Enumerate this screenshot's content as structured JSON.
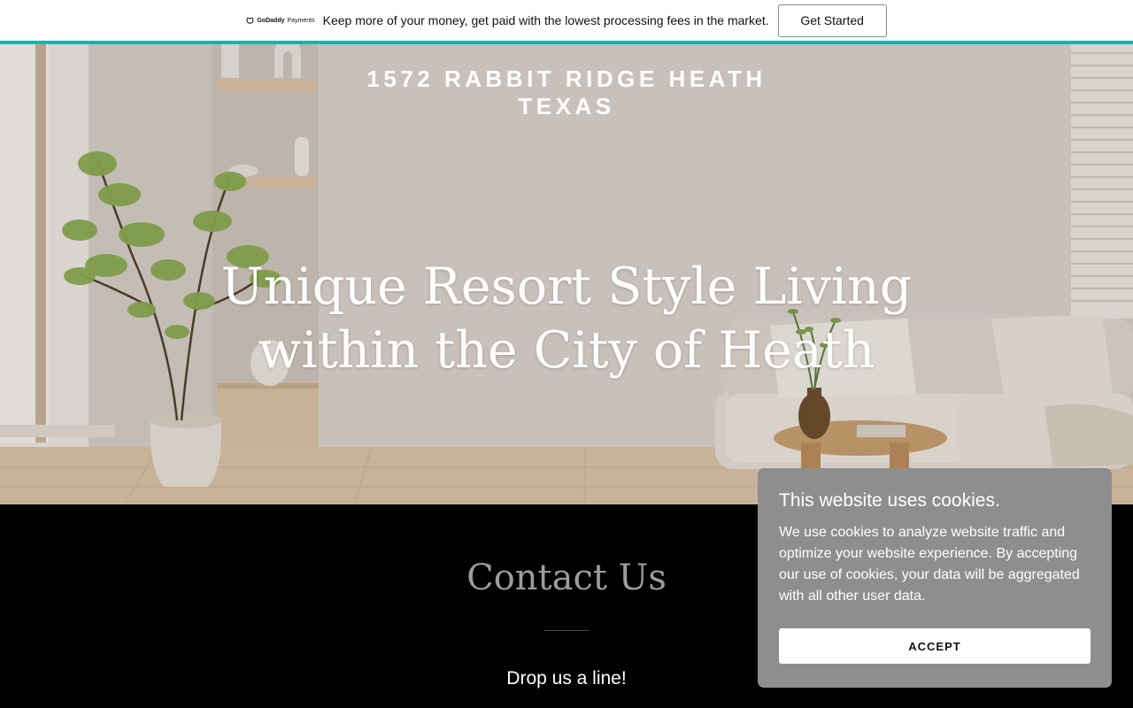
{
  "promo": {
    "logo_brand": "GoDaddy",
    "logo_product": "Payments",
    "message": "Keep more of your money, get paid with the lowest processing fees in the market.",
    "cta_label": "Get Started",
    "accent_color": "#1bb1ad"
  },
  "hero": {
    "site_title_line1": "1572 RABBIT RIDGE HEATH",
    "site_title_line2": "TEXAS",
    "heading_line1": "Unique Resort Style Living",
    "heading_line2": "within the City of Heath"
  },
  "contact": {
    "title": "Contact Us",
    "subtitle": "Drop us a line!"
  },
  "cookie_banner": {
    "title": "This website uses cookies.",
    "body": "We use cookies to analyze website traffic and optimize your website experience. By accepting our use of cookies, your data will be aggregated with all other user data.",
    "accept_label": "ACCEPT"
  }
}
